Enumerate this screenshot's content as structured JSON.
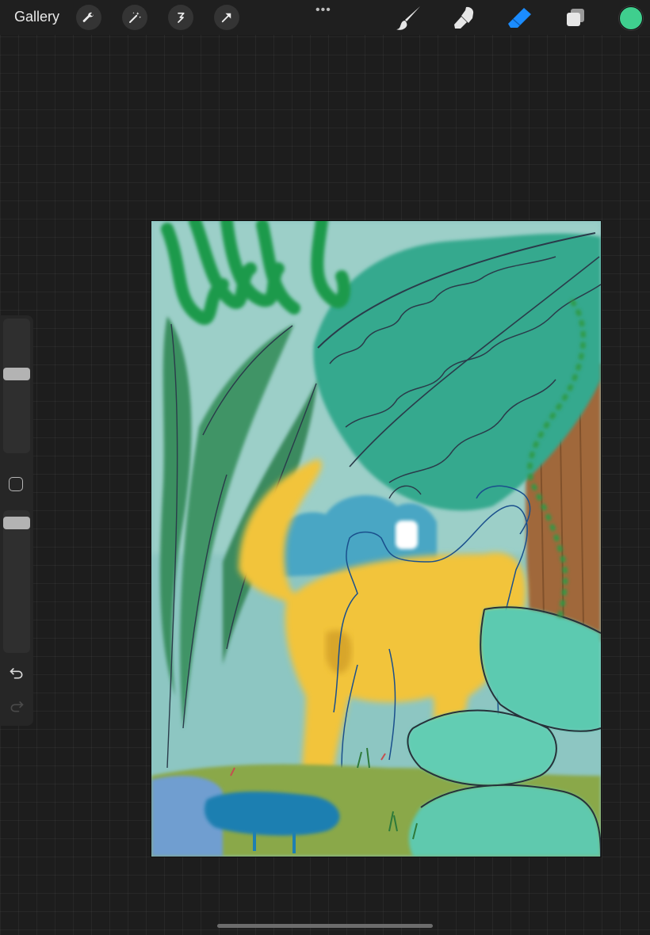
{
  "topbar": {
    "gallery_label": "Gallery",
    "left_tools": [
      {
        "name": "wrench-icon"
      },
      {
        "name": "magic-wand-icon"
      },
      {
        "name": "selection-icon"
      },
      {
        "name": "transform-arrow-icon"
      }
    ],
    "more_label": "•••",
    "right_tools": [
      {
        "name": "brush-icon"
      },
      {
        "name": "smudge-icon"
      },
      {
        "name": "eraser-icon",
        "active": true
      },
      {
        "name": "layers-icon"
      }
    ],
    "active_color": "#3fcf8e",
    "active_tool_color": "#1b8cff"
  },
  "sidebar": {
    "brush_size_level": 0.6,
    "opacity_level": 0.95,
    "modifier_icon": "square-modifier-icon",
    "undo_icon": "undo-icon",
    "redo_icon": "redo-icon"
  }
}
